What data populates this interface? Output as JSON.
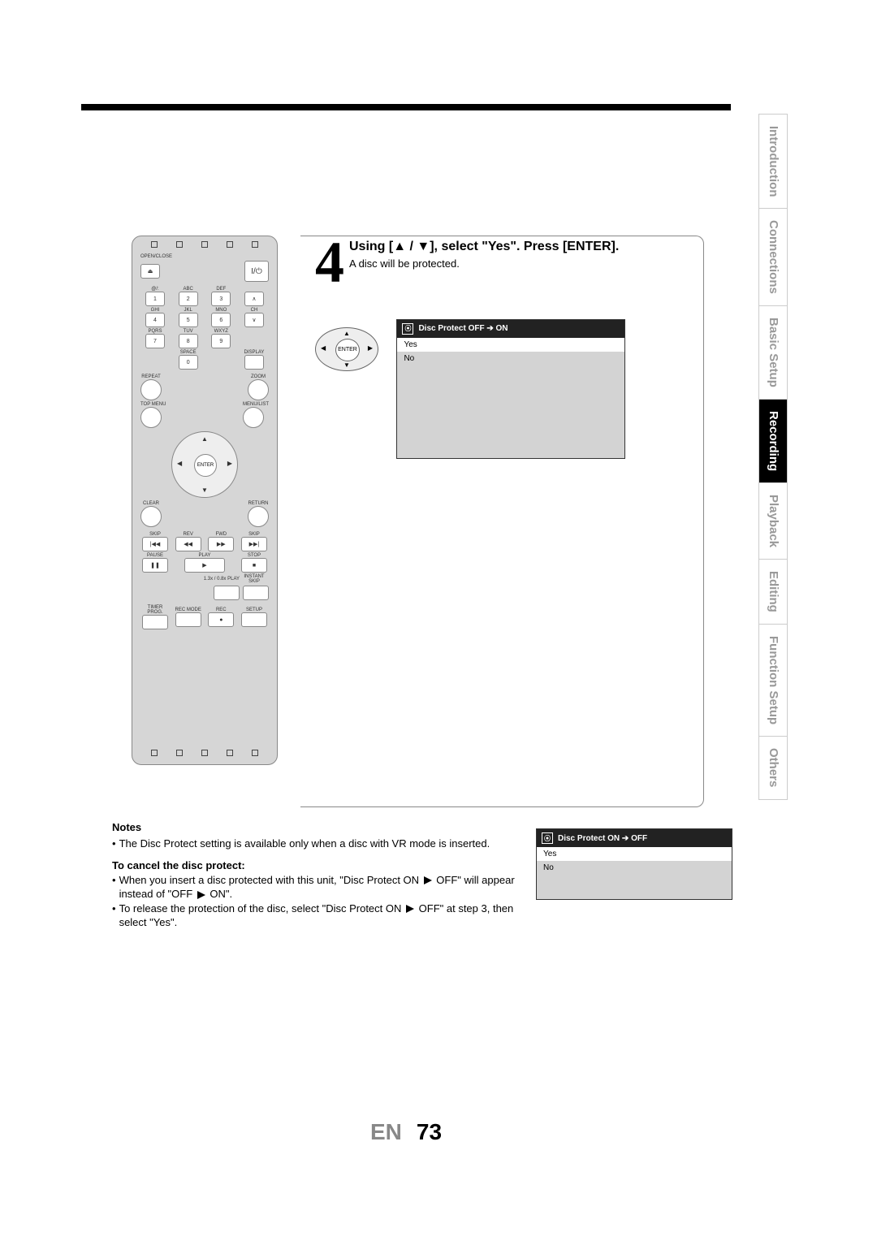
{
  "side_tabs": {
    "introduction": "Introduction",
    "connections": "Connections",
    "basic_setup": "Basic Setup",
    "recording": "Recording",
    "playback": "Playback",
    "editing": "Editing",
    "function_setup": "Function Setup",
    "others": "Others"
  },
  "step": {
    "number": "4",
    "heading": "Using [▲ / ▼], select \"Yes\". Press [ENTER].",
    "sub": "A disc will be protected."
  },
  "enter_label": "ENTER",
  "osd1": {
    "title": "Disc Protect OFF ➔ ON",
    "opt_yes": "Yes",
    "opt_no": "No"
  },
  "osd2": {
    "title": "Disc Protect ON ➔ OFF",
    "opt_yes": "Yes",
    "opt_no": "No"
  },
  "notes": {
    "heading": "Notes",
    "n1": "The Disc Protect setting is available only when a disc with VR mode is inserted.",
    "cancel_heading": "To cancel the disc protect:",
    "n2a": "When you insert a disc protected with this unit, \"Disc Protect ON",
    "n2b": "OFF\" will appear instead of \"OFF",
    "n2c": "ON\".",
    "n3a": "To release the protection of the disc, select \"Disc Protect ON",
    "n3b": "OFF\" at step 3, then select \"Yes\"."
  },
  "remote": {
    "open_close": "OPEN/CLOSE",
    "power": "I/⏻",
    "abc": "ABC",
    "def": "DEF",
    "ghi": "GHI",
    "jkl": "JKL",
    "mno": "MNO",
    "pqrs": "PQRS",
    "tuv": "TUV",
    "wxyz": "WXYZ",
    "space": "SPACE",
    "at": "@/:",
    "ch": "CH",
    "n1": "1",
    "n2": "2",
    "n3": "3",
    "n4": "4",
    "n5": "5",
    "n6": "6",
    "n7": "7",
    "n8": "8",
    "n9": "9",
    "n0": "0",
    "display": "DISPLAY",
    "repeat": "REPEAT",
    "zoom": "ZOOM",
    "top_menu": "TOP MENU",
    "menu_list": "MENU/LIST",
    "enter": "ENTER",
    "clear": "CLEAR",
    "return": "RETURN",
    "skip": "SKIP",
    "rev": "REV",
    "fwd": "FWD",
    "pause": "PAUSE",
    "play": "PLAY",
    "stop": "STOP",
    "speed_play": "1.3x / 0.8x PLAY",
    "instant_skip": "INSTANT SKIP",
    "timer_prog": "TIMER PROG.",
    "rec_mode": "REC MODE",
    "rec": "REC",
    "setup": "SETUP"
  },
  "page_number": {
    "lang": "EN",
    "num": "73"
  }
}
